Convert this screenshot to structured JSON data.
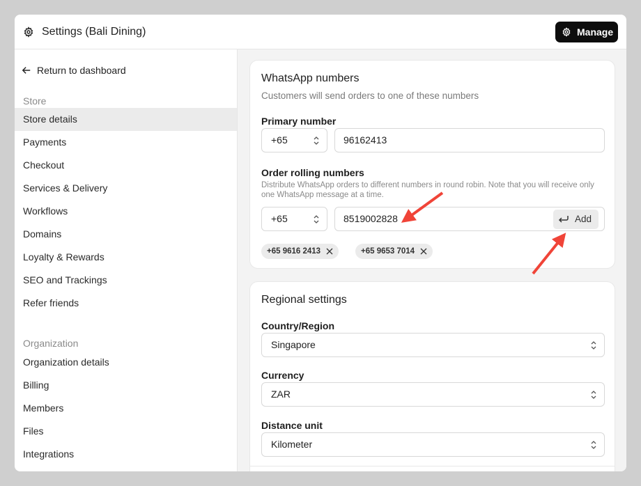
{
  "window": {
    "title": "Settings (Bali Dining)"
  },
  "header": {
    "manage_label": "Manage"
  },
  "sidebar": {
    "return_label": "Return to dashboard",
    "store_section": "Store",
    "store_items": [
      {
        "label": "Store details",
        "active": true
      },
      {
        "label": "Payments"
      },
      {
        "label": "Checkout"
      },
      {
        "label": "Services & Delivery"
      },
      {
        "label": "Workflows"
      },
      {
        "label": "Domains"
      },
      {
        "label": "Loyalty & Rewards"
      },
      {
        "label": "SEO and Trackings"
      },
      {
        "label": "Refer friends"
      }
    ],
    "org_section": "Organization",
    "org_items": [
      {
        "label": "Organization details"
      },
      {
        "label": "Billing"
      },
      {
        "label": "Members"
      },
      {
        "label": "Files"
      },
      {
        "label": "Integrations"
      }
    ]
  },
  "whatsapp": {
    "title": "WhatsApp numbers",
    "subtitle": "Customers will send orders to one of these numbers",
    "primary_label": "Primary number",
    "primary_code": "+65",
    "primary_number": "96162413",
    "rolling_label": "Order rolling numbers",
    "rolling_help": "Distribute WhatsApp orders to different numbers in round robin. Note that you will receive only one WhatsApp message at a time.",
    "rolling_code": "+65",
    "rolling_input": "8519002828",
    "add_label": "Add",
    "chips": [
      "+65 9616 2413",
      "+65 9653 7014"
    ]
  },
  "regional": {
    "title": "Regional settings",
    "country_label": "Country/Region",
    "country_value": "Singapore",
    "currency_label": "Currency",
    "currency_value": "ZAR",
    "distance_label": "Distance unit",
    "distance_value": "Kilometer"
  },
  "colors": {
    "annotation_arrow": "#f04438",
    "manage_bg": "#0d0d0d",
    "active_nav_bg": "#ebebeb"
  }
}
